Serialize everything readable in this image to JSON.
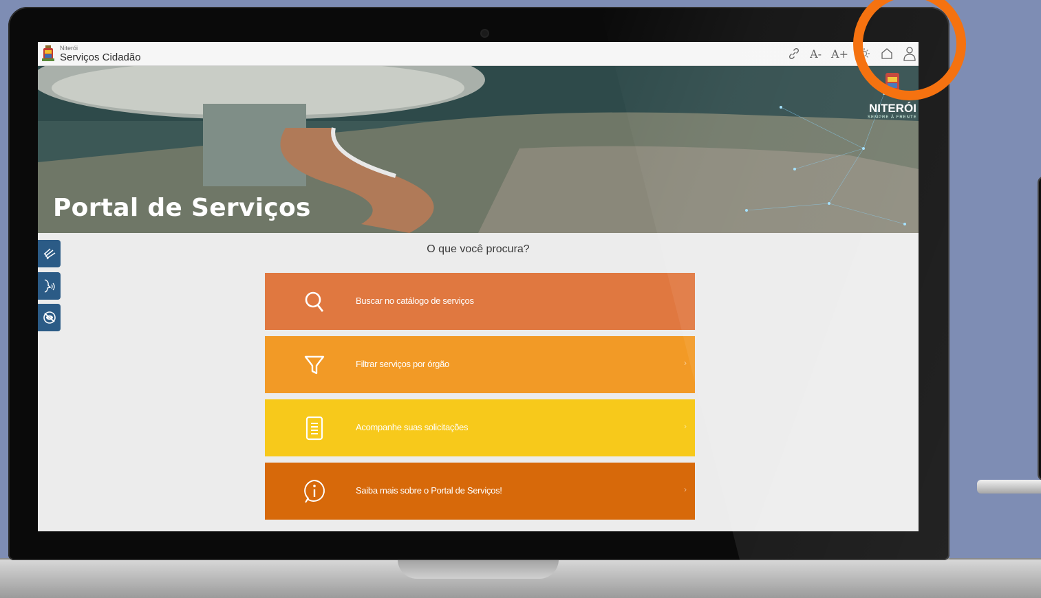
{
  "header": {
    "city_small": "Niterói",
    "portal_name": "Serviços Cidadão",
    "tools": {
      "decrease_font": "A-",
      "increase_font": "A+"
    }
  },
  "hero": {
    "title": "Portal de Serviços",
    "logo_text": "NITERÓI",
    "logo_sub": "SEMPRE À FRENTE"
  },
  "main": {
    "question": "O que você procura?",
    "cards": [
      {
        "label": "Buscar no catálogo de serviços",
        "icon": "search-icon",
        "color": "#e07840"
      },
      {
        "label": "Filtrar serviços por órgão",
        "icon": "filter-icon",
        "color": "#f29a26"
      },
      {
        "label": "Acompanhe suas solicitações",
        "icon": "document-icon",
        "color": "#f7c91b"
      },
      {
        "label": "Saiba mais sobre o Portal de Serviços!",
        "icon": "info-icon",
        "color": "#d7690a"
      }
    ],
    "arrow": "›"
  },
  "accessibility": [
    "sign-language-icon",
    "voice-icon",
    "hide-eye-icon"
  ],
  "colors": {
    "highlight_ring": "#f57210",
    "background": "#7e8db4",
    "a11y_blue": "#2b5b86"
  }
}
